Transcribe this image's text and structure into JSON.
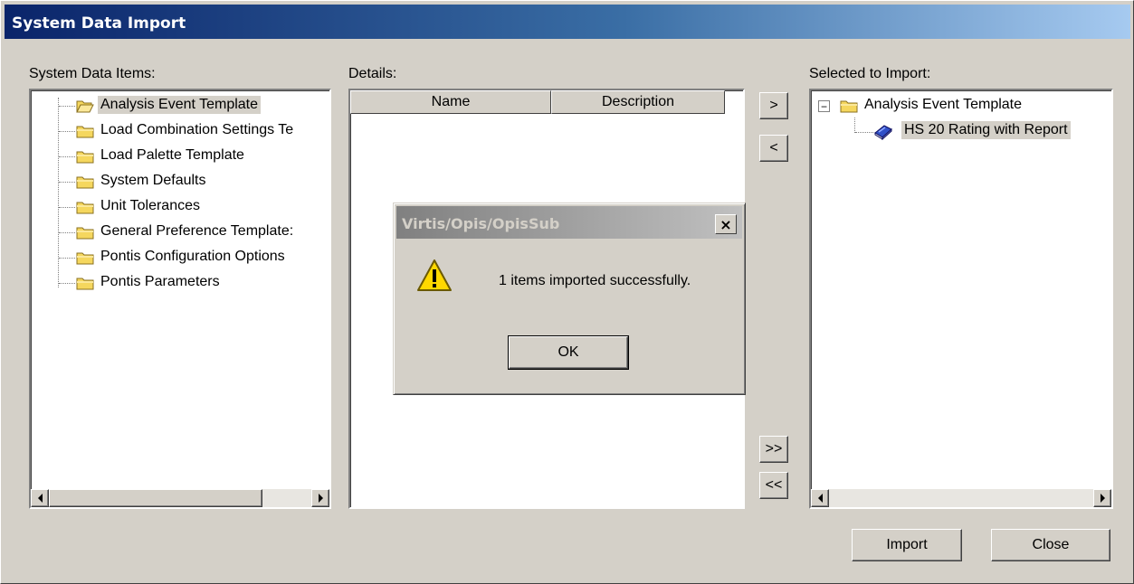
{
  "window": {
    "title": "System Data Import"
  },
  "left_panel": {
    "label": "System Data Items:",
    "items": [
      {
        "label": "Analysis Event Template",
        "icon": "open-folder-icon",
        "selected": true
      },
      {
        "label": "Load Combination Settings Te",
        "icon": "folder-icon"
      },
      {
        "label": "Load Palette Template",
        "icon": "folder-icon"
      },
      {
        "label": "System Defaults",
        "icon": "folder-icon"
      },
      {
        "label": "Unit Tolerances",
        "icon": "folder-icon"
      },
      {
        "label": "General Preference Template:",
        "icon": "folder-icon"
      },
      {
        "label": "Pontis Configuration Options",
        "icon": "folder-icon"
      },
      {
        "label": "Pontis Parameters",
        "icon": "folder-icon"
      }
    ]
  },
  "details": {
    "label": "Details:",
    "columns": [
      "Name",
      "Description"
    ]
  },
  "transfer_buttons": {
    "add": ">",
    "remove": "<",
    "add_all": ">>",
    "remove_all": "<<"
  },
  "right_panel": {
    "label": "Selected to Import:",
    "items": [
      {
        "label": "Analysis Event Template",
        "icon": "folder-icon",
        "expander": "−"
      },
      {
        "label": "HS 20 Rating with Report",
        "icon": "book-icon",
        "selected": true
      }
    ]
  },
  "buttons": {
    "import": "Import",
    "close": "Close"
  },
  "dialog": {
    "title": "Virtis/Opis/OpisSub",
    "message": "1 items imported successfully.",
    "ok": "OK",
    "close_glyph": "×",
    "icon": "warning-icon"
  },
  "colors": {
    "title_gradient_start": "#0a246a",
    "title_gradient_end": "#a6caf0",
    "face": "#d4d0c8",
    "folder": "#f5d75e"
  }
}
